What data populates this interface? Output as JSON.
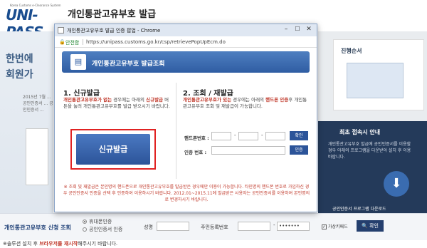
{
  "brand": {
    "logo_text": "UNI-PASS",
    "logo_sub": "Korea Customs e-Clearance System",
    "page_title": "개인통관고유부호 발급"
  },
  "background": {
    "left_heading1": "한번에",
    "left_heading2": "회원가",
    "left_small": "2015년 7월 ... 공인인증서 ... 공인인증서 ...",
    "right_title": "진행순서",
    "right2_title": "최초 접속시 안내",
    "right2_desc": "개인통관고유부호 발급에 공인인증서를 이용할 경우 아래의 프로그램을 다운받아 설치 후 이용 바랍니다.",
    "right2_link": "공인인증서 프로그램 다운로드"
  },
  "bottom": {
    "label": "개인통관고유부호 신청 조회",
    "radio1": "휴대폰인증",
    "radio2": "공인인증서 인증",
    "name_label": "성명",
    "rrn_label": "주민등록번호",
    "dash": "-",
    "rrn2_value": "•••••••",
    "virtual_kb": "가상키패드",
    "confirm": "확인"
  },
  "note": {
    "prefix": "※솔루션 설치 후 ",
    "red": "브라우저를 재시작",
    "suffix": "해주시기 바랍니다."
  },
  "popup": {
    "window_title": "개인통관고유부호 발급 인증 팝업 - Chrome",
    "secure_label": "안전함",
    "url": "https://unipass.customs.go.kr/csp/retrievePopUpEcm.do",
    "banner_title": "개인통관고유부호 발급조회",
    "new": {
      "title": "1. 신규발급",
      "desc_red": "개인통관고유부호가 없는",
      "desc1": " 경우에는 아래의 ",
      "desc_red2": "신규발급",
      "desc2": " 버튼을 눌러 개인통관고유부호를 발급 받으시기 바랍니다.",
      "button": "신규발급"
    },
    "reissue": {
      "title": "2. 조회 / 재발급",
      "desc_red": "개인통관고유부호가 있는",
      "desc1": " 경우에는 아래의 ",
      "desc_red2": "핸드폰 인증",
      "desc2": "후 개인통관고유부호 조회 및 재발급이 가능합니다.",
      "phone_label": "핸드폰번호 :",
      "confirm": "확인",
      "code_label": "인증 번호 :",
      "auth": "인증"
    },
    "footnote": "※ 조회 및 재발급은 본인명의 핸드폰으로 개인통관고유부호를 발급받은 경우에만 이용이 가능합니다. 타인명의 핸드폰 번호로 가입하신 경우 공인인증서 인증을 선택 후 인증하여 이용하시기 바랍니다. 2012.01~2015.11에 발급받은 사용자는 공인인증서를 이용하여 본인명의로 변경하시기 바랍니다."
  }
}
